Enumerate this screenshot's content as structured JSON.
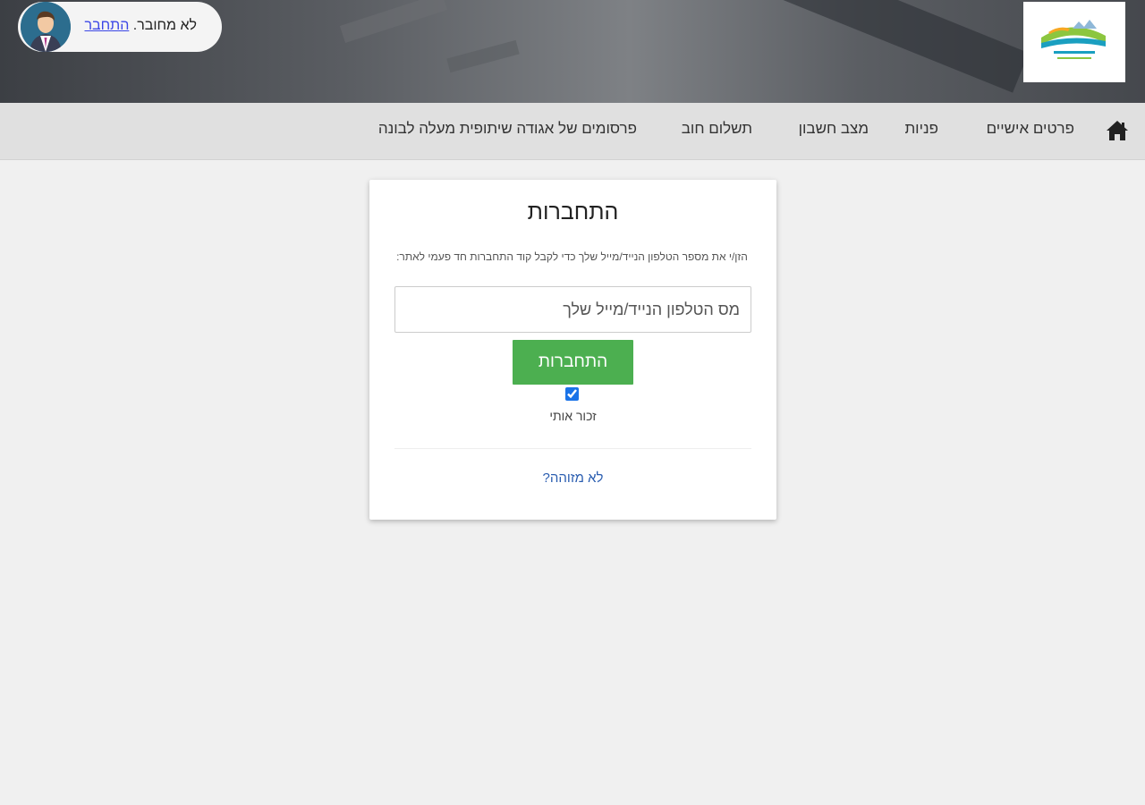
{
  "header": {
    "user_status_text": "לא מחובר.",
    "login_link_label": "התחבר",
    "logo_name": "maale-levona-logo"
  },
  "nav": {
    "home_icon": "home-icon",
    "items": [
      {
        "label": "פרטים אישיים"
      },
      {
        "label": "פניות"
      },
      {
        "label": "מצב חשבון"
      },
      {
        "label": "תשלום חוב"
      },
      {
        "label": "פרסומים של אגודה שיתופית מעלה לבונה"
      }
    ]
  },
  "login": {
    "title": "התחברות",
    "instructions": "הזן/י את מספר הטלפון הנייד/מייל שלך כדי לקבל קוד התחברות חד פעמי לאתר:",
    "phone_placeholder": "מס הטלפון הנייד/מייל שלך",
    "button_label": "התחברות",
    "remember_me_label": "זכור אותי",
    "remember_me_checked": true,
    "not_identified_link": "לא מזוהה?"
  },
  "colors": {
    "accent_green": "#4caf50",
    "nav_bg": "#e0e0e0",
    "link_blue": "#2a5db0"
  }
}
